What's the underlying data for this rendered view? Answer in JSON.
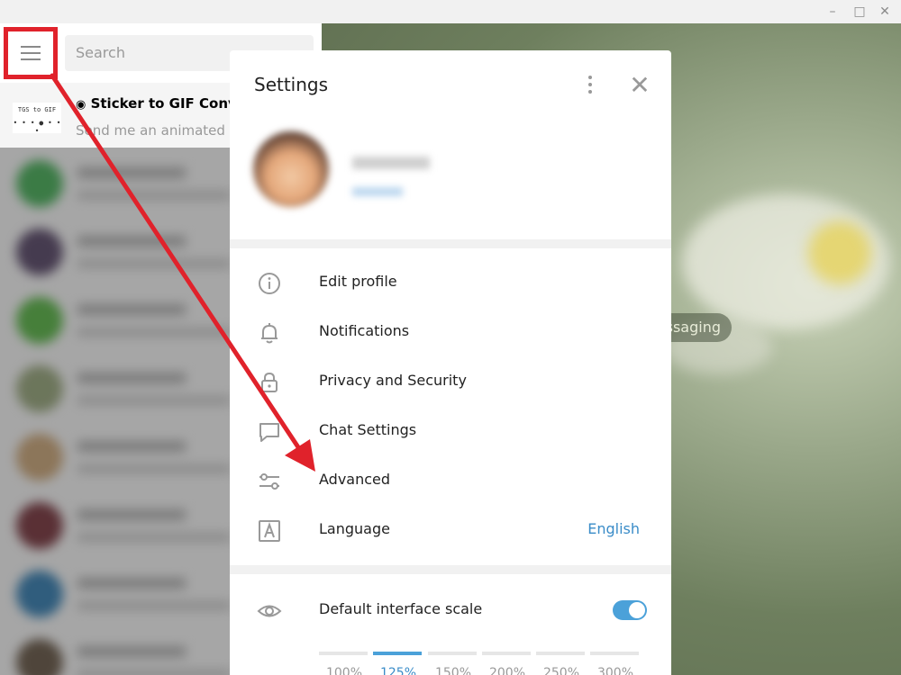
{
  "window": {
    "minimize_glyph": "–",
    "maximize_glyph": "□",
    "close_glyph": "✕"
  },
  "left": {
    "search_placeholder": "Search",
    "pinned_chat": {
      "title": "Sticker to GIF Conv",
      "preview": "Send me an animated s",
      "avatar_text": "TGS to GIF"
    }
  },
  "background": {
    "pill_text": "ssaging"
  },
  "settings": {
    "title": "Settings",
    "menu": [
      {
        "label": "Edit profile",
        "icon": "info-icon"
      },
      {
        "label": "Notifications",
        "icon": "bell-icon"
      },
      {
        "label": "Privacy and Security",
        "icon": "lock-icon"
      },
      {
        "label": "Chat Settings",
        "icon": "chat-bubble-icon"
      },
      {
        "label": "Advanced",
        "icon": "sliders-icon"
      },
      {
        "label": "Language",
        "icon": "language-icon",
        "value": "English"
      }
    ],
    "scale": {
      "label": "Default interface scale",
      "icon": "eye-icon",
      "enabled": true,
      "options": [
        "100%",
        "125%",
        "150%",
        "200%",
        "250%",
        "300%"
      ],
      "selected": "125%"
    }
  },
  "colors": {
    "accent": "#4ba1d9",
    "annotation": "#e0222b"
  }
}
